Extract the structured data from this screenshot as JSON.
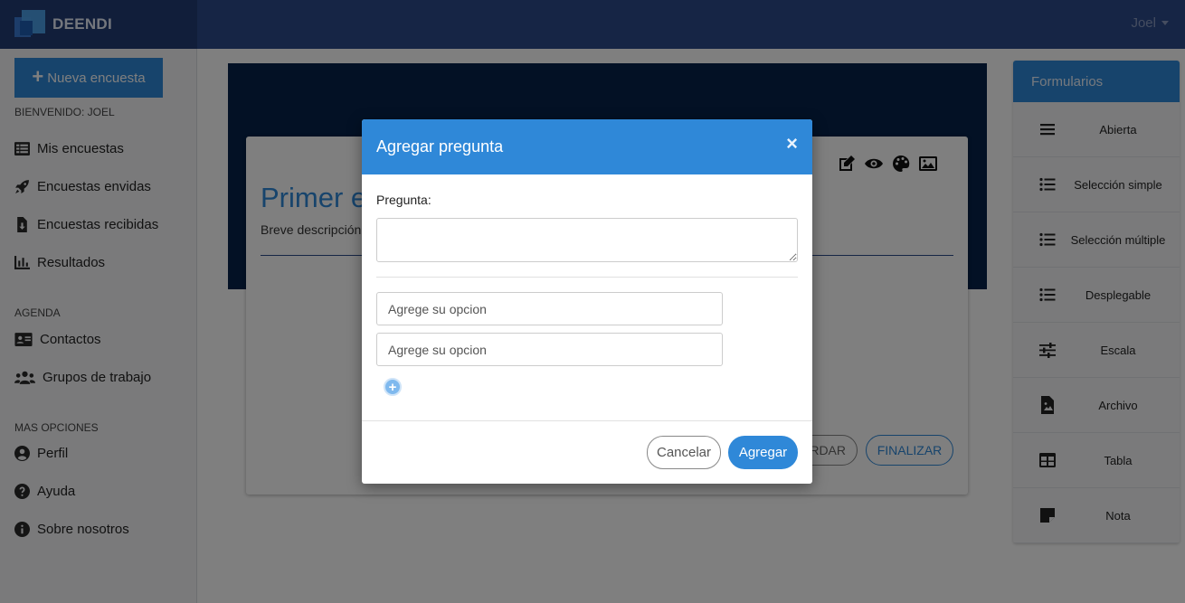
{
  "app": {
    "brand": "DEENDI",
    "user": "Joel"
  },
  "sidebar": {
    "new_survey": "Nueva encuesta",
    "welcome": "BIENVENIDO: JOEL",
    "items": [
      {
        "label": "Mis encuestas",
        "icon": "list-icon"
      },
      {
        "label": "Encuestas envidas",
        "icon": "rocket-icon"
      },
      {
        "label": "Encuestas recibidas",
        "icon": "file-download-icon"
      },
      {
        "label": "Resultados",
        "icon": "chart-bar-icon"
      }
    ],
    "agenda_label": "AGENDA",
    "agenda": [
      {
        "label": "Contactos",
        "icon": "address-card-icon"
      },
      {
        "label": "Grupos de trabajo",
        "icon": "users-icon"
      }
    ],
    "more_label": "MAS OPCIONES",
    "more": [
      {
        "label": "Perfil",
        "icon": "user-circle-icon"
      },
      {
        "label": "Ayuda",
        "icon": "question-circle-icon"
      },
      {
        "label": "Sobre nosotros",
        "icon": "info-circle-icon"
      }
    ]
  },
  "survey": {
    "title": "Primer e",
    "description": "Breve descripción",
    "save_label": "RDAR",
    "finish_label": "FINALIZAR"
  },
  "forms_panel": {
    "title": "Formularios",
    "items": [
      {
        "label": "Abierta",
        "icon": "bars-icon"
      },
      {
        "label": "Selección simple",
        "icon": "list-ul-icon"
      },
      {
        "label": "Selección múltiple",
        "icon": "list-ul-icon"
      },
      {
        "label": "Desplegable",
        "icon": "list-ul-icon"
      },
      {
        "label": "Escala",
        "icon": "sliders-icon"
      },
      {
        "label": "Archivo",
        "icon": "file-image-icon"
      },
      {
        "label": "Tabla",
        "icon": "table-icon"
      },
      {
        "label": "Nota",
        "icon": "sticky-note-icon"
      }
    ]
  },
  "modal": {
    "title": "Agregar pregunta",
    "close": "×",
    "question_label": "Pregunta:",
    "question_value": "",
    "option_placeholder": "Agrege su opcion",
    "add_option": "+",
    "cancel": "Cancelar",
    "add": "Agregar"
  },
  "colors": {
    "primary": "#2f88d8",
    "topbar": "#2c4a8a",
    "banner": "#06224a"
  }
}
